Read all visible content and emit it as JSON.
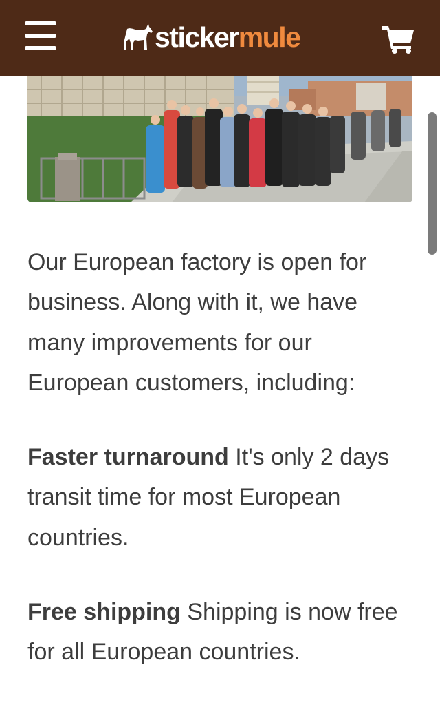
{
  "header": {
    "menu_icon": "hamburger-menu-icon",
    "logo": {
      "icon": "mule-icon",
      "text_part1": "sticker",
      "text_part2": "mule",
      "color_part1": "#ffffff",
      "color_part2": "#f08a3e"
    },
    "cart_icon": "shopping-cart-icon",
    "background": "#4e2a17"
  },
  "hero_image": {
    "description_icon": "team-photo-pisa"
  },
  "article": {
    "intro": "Our European factory is open for business. Along with it, we have many improvements for our European customers, including:",
    "features": [
      {
        "title": "Faster turnaround",
        "text": " It's only 2 days transit time for most European countries."
      },
      {
        "title": "Free shipping",
        "text": " Shipping is now free for all European countries."
      }
    ]
  }
}
